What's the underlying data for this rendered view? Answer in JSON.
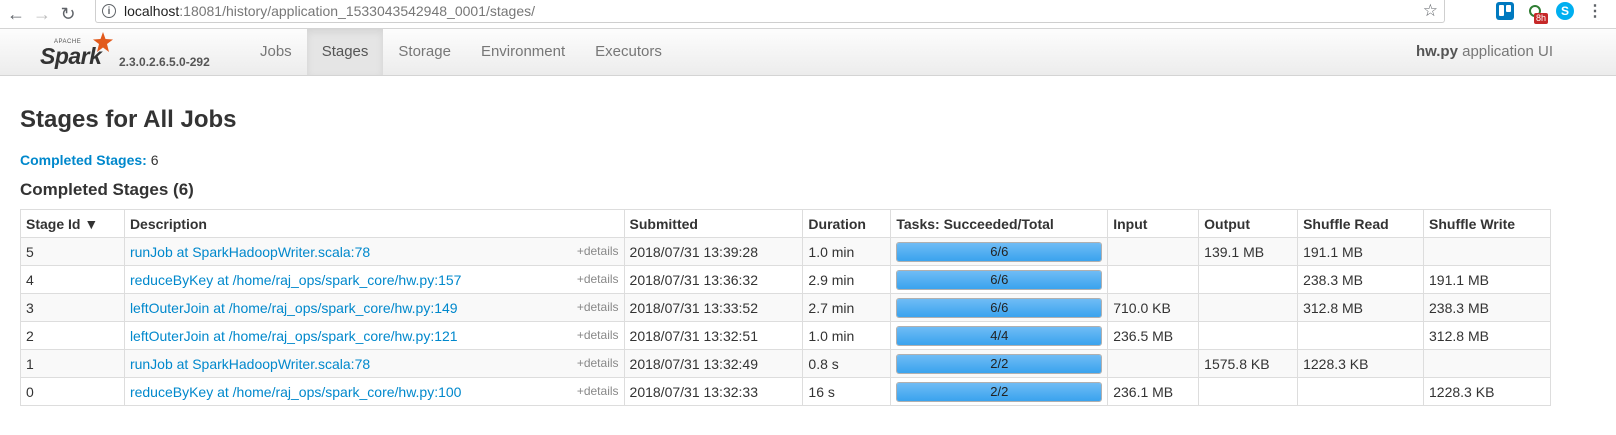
{
  "browser": {
    "url_host": "localhost",
    "url_rest": ":18081/history/application_1533043542948_0001/stages/",
    "timer_badge": "8h"
  },
  "nav": {
    "apache": "APACHE",
    "spark": "Spark",
    "version": "2.3.0.2.6.5.0-292",
    "tabs": [
      {
        "label": "Jobs"
      },
      {
        "label": "Stages"
      },
      {
        "label": "Storage"
      },
      {
        "label": "Environment"
      },
      {
        "label": "Executors"
      }
    ],
    "app_name": "hw.py",
    "app_suffix": " application UI"
  },
  "page": {
    "title": "Stages for All Jobs",
    "summary_label": "Completed Stages:",
    "summary_count": " 6",
    "section_title": "Completed Stages (6)"
  },
  "table": {
    "headers": {
      "stage_id": "Stage Id ▼",
      "description": "Description",
      "submitted": "Submitted",
      "duration": "Duration",
      "tasks": "Tasks: Succeeded/Total",
      "input": "Input",
      "output": "Output",
      "shuffle_read": "Shuffle Read",
      "shuffle_write": "Shuffle Write"
    },
    "details_label": "+details",
    "rows": [
      {
        "id": "5",
        "desc": "runJob at SparkHadoopWriter.scala:78",
        "submitted": "2018/07/31 13:39:28",
        "duration": "1.0 min",
        "tasks": "6/6",
        "progress": 1.0,
        "input": "",
        "output": "139.1 MB",
        "shuffle_read": "191.1 MB",
        "shuffle_write": ""
      },
      {
        "id": "4",
        "desc": "reduceByKey at /home/raj_ops/spark_core/hw.py:157",
        "submitted": "2018/07/31 13:36:32",
        "duration": "2.9 min",
        "tasks": "6/6",
        "progress": 1.0,
        "input": "",
        "output": "",
        "shuffle_read": "238.3 MB",
        "shuffle_write": "191.1 MB"
      },
      {
        "id": "3",
        "desc": "leftOuterJoin at /home/raj_ops/spark_core/hw.py:149",
        "submitted": "2018/07/31 13:33:52",
        "duration": "2.7 min",
        "tasks": "6/6",
        "progress": 1.0,
        "input": "710.0 KB",
        "output": "",
        "shuffle_read": "312.8 MB",
        "shuffle_write": "238.3 MB"
      },
      {
        "id": "2",
        "desc": "leftOuterJoin at /home/raj_ops/spark_core/hw.py:121",
        "submitted": "2018/07/31 13:32:51",
        "duration": "1.0 min",
        "tasks": "4/4",
        "progress": 1.0,
        "input": "236.5 MB",
        "output": "",
        "shuffle_read": "",
        "shuffle_write": "312.8 MB"
      },
      {
        "id": "1",
        "desc": "runJob at SparkHadoopWriter.scala:78",
        "submitted": "2018/07/31 13:32:49",
        "duration": "0.8 s",
        "tasks": "2/2",
        "progress": 1.0,
        "input": "",
        "output": "1575.8 KB",
        "shuffle_read": "1228.3 KB",
        "shuffle_write": ""
      },
      {
        "id": "0",
        "desc": "reduceByKey at /home/raj_ops/spark_core/hw.py:100",
        "submitted": "2018/07/31 13:32:33",
        "duration": "16 s",
        "tasks": "2/2",
        "progress": 1.0,
        "input": "236.1 MB",
        "output": "",
        "shuffle_read": "",
        "shuffle_write": "1228.3 KB"
      }
    ]
  }
}
